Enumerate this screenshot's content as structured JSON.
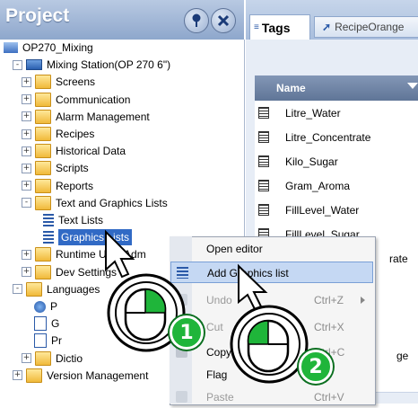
{
  "project_panel": {
    "title": "Project",
    "tree": [
      {
        "label": "OP270_Mixing",
        "icon": "project-icon",
        "indent": 0,
        "expander": ""
      },
      {
        "label": "Mixing Station(OP 270 6\")",
        "icon": "device-icon",
        "indent": 1,
        "expander": "-"
      },
      {
        "label": "Screens",
        "icon": "folder-icon",
        "indent": 2,
        "expander": "+"
      },
      {
        "label": "Communication",
        "icon": "folder-icon",
        "indent": 2,
        "expander": "+"
      },
      {
        "label": "Alarm Management",
        "icon": "folder-icon",
        "indent": 2,
        "expander": "+"
      },
      {
        "label": "Recipes",
        "icon": "folder-icon",
        "indent": 2,
        "expander": "+"
      },
      {
        "label": "Historical Data",
        "icon": "folder-icon",
        "indent": 2,
        "expander": "+"
      },
      {
        "label": "Scripts",
        "icon": "folder-icon",
        "indent": 2,
        "expander": "+"
      },
      {
        "label": "Reports",
        "icon": "folder-icon",
        "indent": 2,
        "expander": "+"
      },
      {
        "label": "Text and Graphics Lists",
        "icon": "folder-icon",
        "indent": 2,
        "expander": "-"
      },
      {
        "label": "Text Lists",
        "icon": "text-list-icon",
        "indent": 3,
        "expander": ""
      },
      {
        "label": "Graphics Lists",
        "icon": "graphics-list-icon",
        "indent": 3,
        "expander": "",
        "selected": true
      },
      {
        "label": "Runtime User Adm",
        "icon": "folder-icon",
        "indent": 2,
        "expander": "+"
      },
      {
        "label": "Dev Settings",
        "icon": "folder-icon",
        "indent": 2,
        "expander": "+"
      },
      {
        "label": "Languages",
        "icon": "folder-icon",
        "indent": 1,
        "expander": "-"
      },
      {
        "label": "P",
        "icon": "globe-icon",
        "indent": 2,
        "expander": ""
      },
      {
        "label": "G",
        "icon": "graphic-icon",
        "indent": 2,
        "expander": ""
      },
      {
        "label": "Pr",
        "icon": "document-icon",
        "indent": 2,
        "expander": ""
      },
      {
        "label": "Dictio",
        "icon": "folder-icon",
        "indent": 2,
        "expander": "+"
      },
      {
        "label": "Version Management",
        "icon": "folder-icon",
        "indent": 1,
        "expander": "+"
      }
    ]
  },
  "editor": {
    "tabs": [
      {
        "label": "Tags",
        "icon": "tags-icon",
        "active": true
      },
      {
        "label": "RecipeOrange",
        "icon": "recipe-icon",
        "active": false
      }
    ],
    "column_header": "Name",
    "rows": [
      "Litre_Water",
      "Litre_Concentrate",
      "Kilo_Sugar",
      "Gram_Aroma",
      "FillLevel_Water",
      "FillLevel_Sugar"
    ],
    "partial_text": {
      "row7": "rate",
      "row10": "ge"
    }
  },
  "context_menu": {
    "items": [
      {
        "label": "Open editor",
        "shortcut": "",
        "highlighted": false,
        "disabled": false
      },
      {
        "label": "Add Graphics list",
        "shortcut": "",
        "highlighted": true,
        "disabled": false
      },
      {
        "label": "Undo",
        "shortcut": "Ctrl+Z",
        "highlighted": false,
        "disabled": true,
        "submenu": true
      },
      {
        "label": "Cut",
        "shortcut": "Ctrl+X",
        "highlighted": false,
        "disabled": true
      },
      {
        "label": "Copy",
        "shortcut": "Ctrl+C",
        "highlighted": false,
        "disabled": false
      },
      {
        "label": "Flag",
        "shortcut": "",
        "highlighted": false,
        "disabled": false
      },
      {
        "label": "Paste",
        "shortcut": "Ctrl+V",
        "highlighted": false,
        "disabled": true
      }
    ]
  },
  "steps": [
    {
      "number": "1",
      "action": "right-click"
    },
    {
      "number": "2",
      "action": "left-click"
    }
  ],
  "colors": {
    "header": "#8ea7cc",
    "selection": "#316ac5",
    "badge": "#1fb53a",
    "menu_highlight": "#c5d8f3"
  }
}
